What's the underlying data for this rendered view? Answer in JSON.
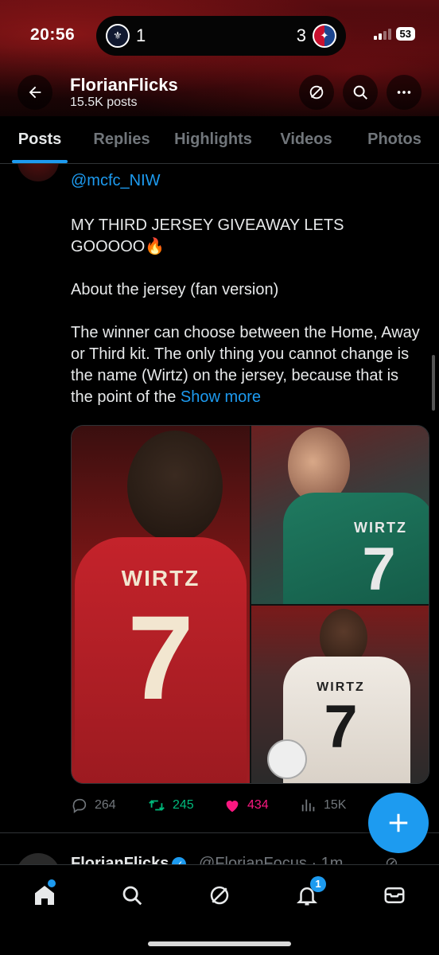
{
  "status_bar": {
    "time": "20:56",
    "live_activity": {
      "home_score": "1",
      "away_score": "3",
      "home_team_icon": "tottenham-crest-icon",
      "away_team_icon": "crystal-palace-crest-icon"
    },
    "battery": "53"
  },
  "profile": {
    "name": "FlorianFlicks",
    "posts_count": "15.5K posts"
  },
  "tabs": [
    {
      "label": "Posts",
      "active": true
    },
    {
      "label": "Replies",
      "active": false
    },
    {
      "label": "Highlights",
      "active": false
    },
    {
      "label": "Videos",
      "active": false
    },
    {
      "label": "Photos",
      "active": false
    }
  ],
  "post": {
    "handle": "@mcfc_NIW",
    "paragraph_1": "MY THIRD JERSEY GIVEAWAY LETS GOOOOO🔥",
    "paragraph_2": "About the jersey (fan version)",
    "paragraph_3": "The winner can choose between the Home, Away or Third kit. The only thing you cannot change is the name (Wirtz) on the jersey, because that is the point of the",
    "show_more": "Show more",
    "media": {
      "left_jersey_name": "WIRTZ",
      "left_jersey_number": "7",
      "top_right_jersey_name": "WIRTZ",
      "top_right_jersey_number": "7",
      "bottom_right_jersey_name": "WIRTZ",
      "bottom_right_jersey_number": "7"
    },
    "stats": {
      "replies": "264",
      "reposts": "245",
      "likes": "434",
      "views": "15K"
    }
  },
  "next_post": {
    "name": "FlorianFlicks",
    "handle_time": "@FlorianFocus · 1m"
  },
  "bottom_nav": {
    "notifications_badge": "1"
  },
  "colors": {
    "accent": "#1d9bf0",
    "repost": "#00ba7c",
    "like": "#f91880",
    "secondary_text": "#71767b"
  }
}
